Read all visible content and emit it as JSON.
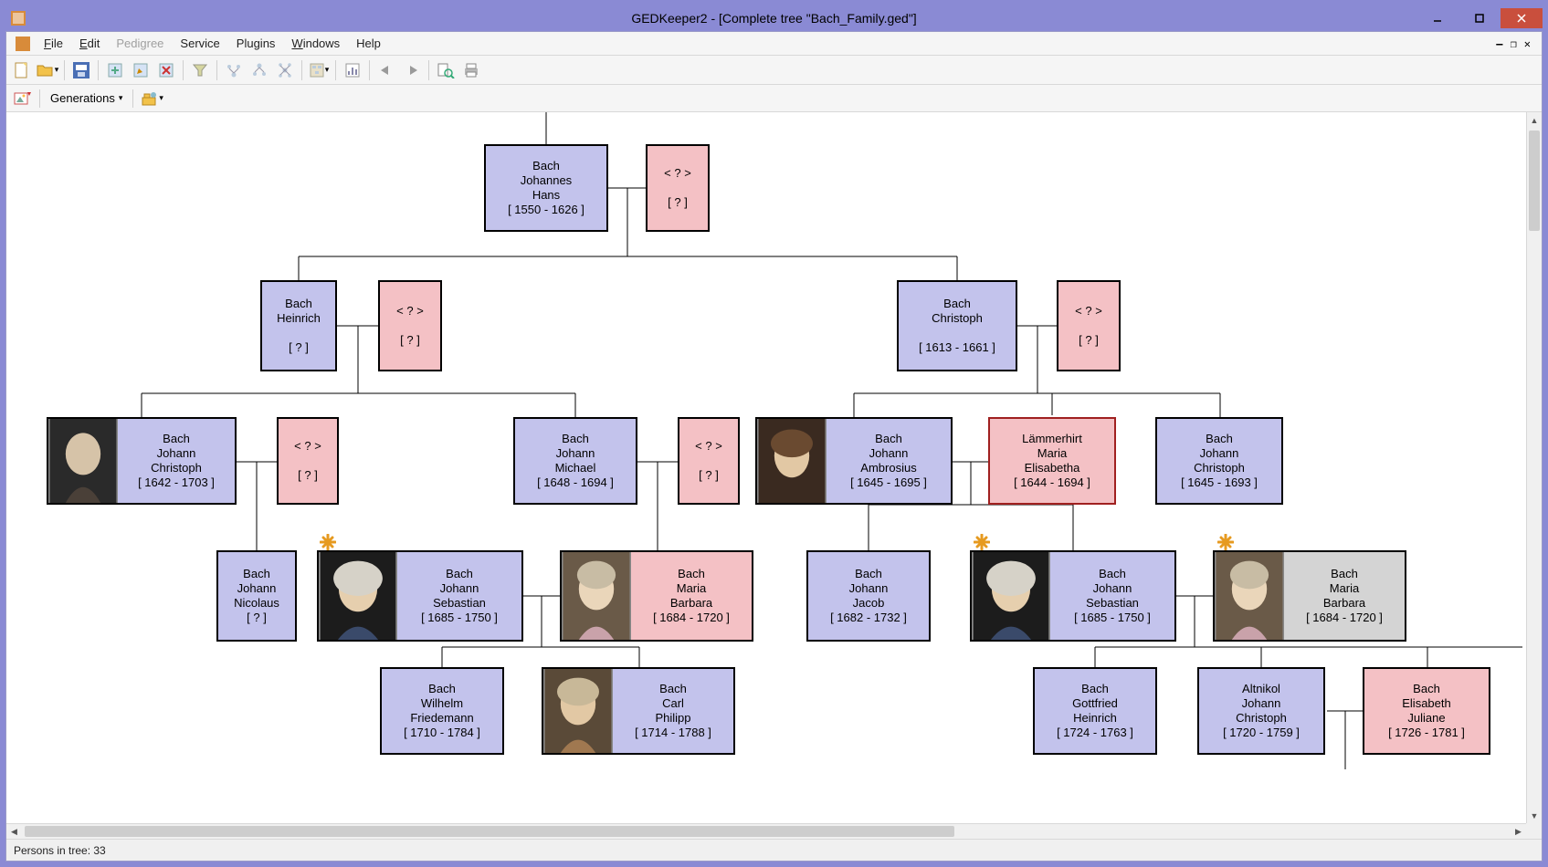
{
  "window": {
    "title": "GEDKeeper2 - [Complete tree \"Bach_Family.ged\"]"
  },
  "menu": {
    "file": "File",
    "edit": "Edit",
    "pedigree": "Pedigree",
    "service": "Service",
    "plugins": "Plugins",
    "windows": "Windows",
    "help": "Help"
  },
  "toolbar2": {
    "generations": "Generations"
  },
  "status": {
    "persons": "Persons in tree: 33"
  },
  "persons": {
    "johannes": {
      "surname": "Bach",
      "given1": "Johannes",
      "given2": "Hans",
      "dates": "[ 1550 - 1626 ]"
    },
    "unk1": {
      "name": "< ? >",
      "dates": "[ ? ]"
    },
    "heinrich": {
      "surname": "Bach",
      "given1": "Heinrich",
      "dates": "[ ? ]"
    },
    "unk2": {
      "name": "< ? >",
      "dates": "[ ? ]"
    },
    "christoph1": {
      "surname": "Bach",
      "given1": "Christoph",
      "dates": "[ 1613 - 1661 ]"
    },
    "unk3": {
      "name": "< ? >",
      "dates": "[ ? ]"
    },
    "jchristoph1": {
      "surname": "Bach",
      "given1": "Johann",
      "given2": "Christoph",
      "dates": "[ 1642 - 1703 ]"
    },
    "unk4": {
      "name": "< ? >",
      "dates": "[ ? ]"
    },
    "jmichael": {
      "surname": "Bach",
      "given1": "Johann",
      "given2": "Michael",
      "dates": "[ 1648 - 1694 ]"
    },
    "unk5": {
      "name": "< ? >",
      "dates": "[ ? ]"
    },
    "jambrosius": {
      "surname": "Bach",
      "given1": "Johann",
      "given2": "Ambrosius",
      "dates": "[ 1645 - 1695 ]"
    },
    "laemmerhirt": {
      "surname": "Lämmerhirt",
      "given1": "Maria",
      "given2": "Elisabetha",
      "dates": "[ 1644 - 1694 ]"
    },
    "jchristoph2": {
      "surname": "Bach",
      "given1": "Johann",
      "given2": "Christoph",
      "dates": "[ 1645 - 1693 ]"
    },
    "jnicolaus": {
      "surname": "Bach",
      "given1": "Johann",
      "given2": "Nicolaus",
      "dates": "[ ? ]"
    },
    "jsebastian1": {
      "surname": "Bach",
      "given1": "Johann",
      "given2": "Sebastian",
      "dates": "[ 1685 - 1750 ]"
    },
    "mbarbara1": {
      "surname": "Bach",
      "given1": "Maria",
      "given2": "Barbara",
      "dates": "[ 1684 - 1720 ]"
    },
    "jjacob": {
      "surname": "Bach",
      "given1": "Johann",
      "given2": "Jacob",
      "dates": "[ 1682 - 1732 ]"
    },
    "jsebastian2": {
      "surname": "Bach",
      "given1": "Johann",
      "given2": "Sebastian",
      "dates": "[ 1685 - 1750 ]"
    },
    "mbarbara2": {
      "surname": "Bach",
      "given1": "Maria",
      "given2": "Barbara",
      "dates": "[ 1684 - 1720 ]"
    },
    "wfriedemann": {
      "surname": "Bach",
      "given1": "Wilhelm",
      "given2": "Friedemann",
      "dates": "[ 1710 - 1784 ]"
    },
    "cphilipp": {
      "surname": "Bach",
      "given1": "Carl",
      "given2": "Philipp",
      "dates": "[ 1714 - 1788 ]"
    },
    "gheinrich": {
      "surname": "Bach",
      "given1": "Gottfried",
      "given2": "Heinrich",
      "dates": "[ 1724 - 1763 ]"
    },
    "altnikol": {
      "surname": "Altnikol",
      "given1": "Johann",
      "given2": "Christoph",
      "dates": "[ 1720 - 1759 ]"
    },
    "ejuliane": {
      "surname": "Bach",
      "given1": "Elisabeth",
      "given2": "Juliane",
      "dates": "[ 1726 - 1781 ]"
    }
  }
}
